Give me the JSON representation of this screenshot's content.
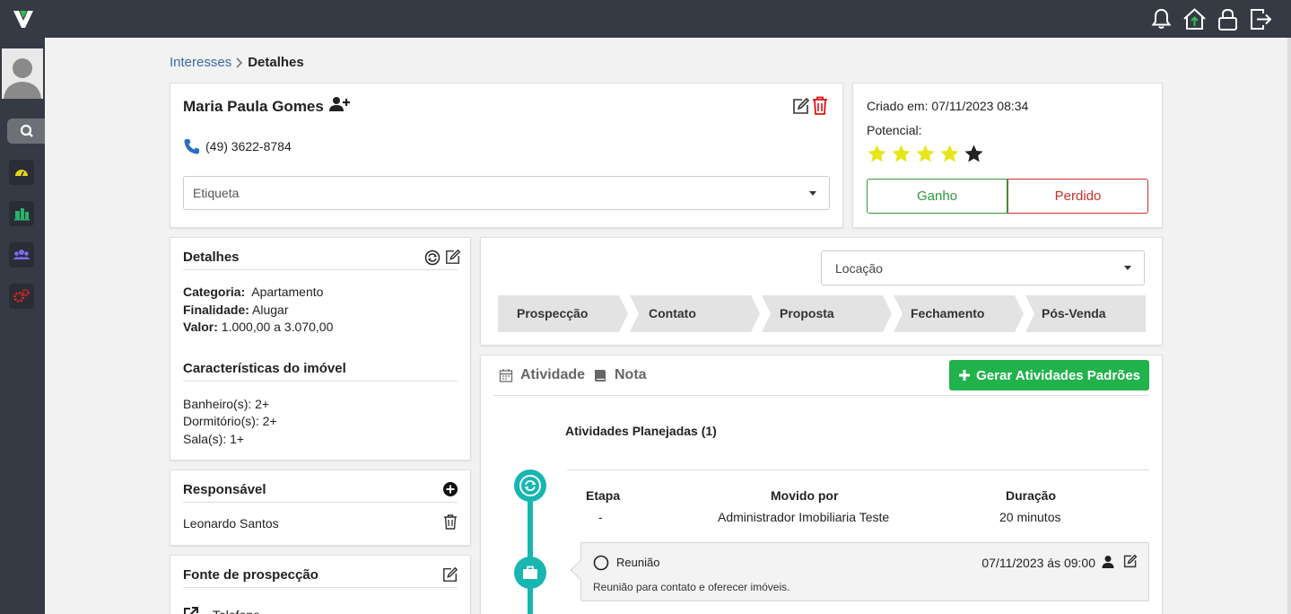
{
  "breadcrumb": {
    "parent": "Interesses",
    "current": "Detalhes"
  },
  "contact": {
    "name": "Maria Paula Gomes",
    "phone": "(49) 3622-8784",
    "tag_placeholder": "Etiqueta"
  },
  "lead": {
    "created": "Criado em: 07/11/2023 08:34",
    "potential_label": "Potencial:",
    "rating": 4,
    "rating_max": 5,
    "won_label": "Ganho",
    "lost_label": "Perdido"
  },
  "details": {
    "title": "Detalhes",
    "category_label": "Categoria:",
    "category_value": "Apartamento",
    "purpose_label": "Finalidade:",
    "purpose_value": "Alugar",
    "value_label": "Valor:",
    "value_value": "1.000,00 a 3.070,00",
    "features_title": "Características do imóvel",
    "features": [
      "Banheiro(s): 2+",
      "Dormitório(s): 2+",
      "Sala(s): 1+"
    ]
  },
  "responsible": {
    "title": "Responsável",
    "name": "Leonardo Santos"
  },
  "source": {
    "title": "Fonte de prospecção",
    "value": "Telefone"
  },
  "funnel": {
    "selected": "Locação",
    "stages": [
      "Prospecção",
      "Contato",
      "Proposta",
      "Fechamento",
      "Pós-Venda"
    ]
  },
  "activity": {
    "tab_activity": "Atividade",
    "tab_note": "Nota",
    "generate_label": "Gerar Atividades Padrões",
    "planned_title": "Atividades Planejadas (1)",
    "col_stage": "Etapa",
    "col_moved_by": "Movido por",
    "col_duration": "Duração",
    "stage_value": "-",
    "moved_by_value": "Administrador Imobiliaria Teste",
    "duration_value": "20 minutos",
    "item_title": "Reunião",
    "item_datetime": "07/11/2023 ás 09:00",
    "item_desc": "Reunião para contato e oferecer imóveis."
  },
  "colors": {
    "topbar": "#363a45",
    "link": "#3b6aa3",
    "star_on": "#e6e619",
    "star_off": "#222222",
    "won": "#2e9a3c",
    "lost": "#c9302c",
    "accent_green": "#22b24c",
    "timeline": "#17b6b0"
  }
}
